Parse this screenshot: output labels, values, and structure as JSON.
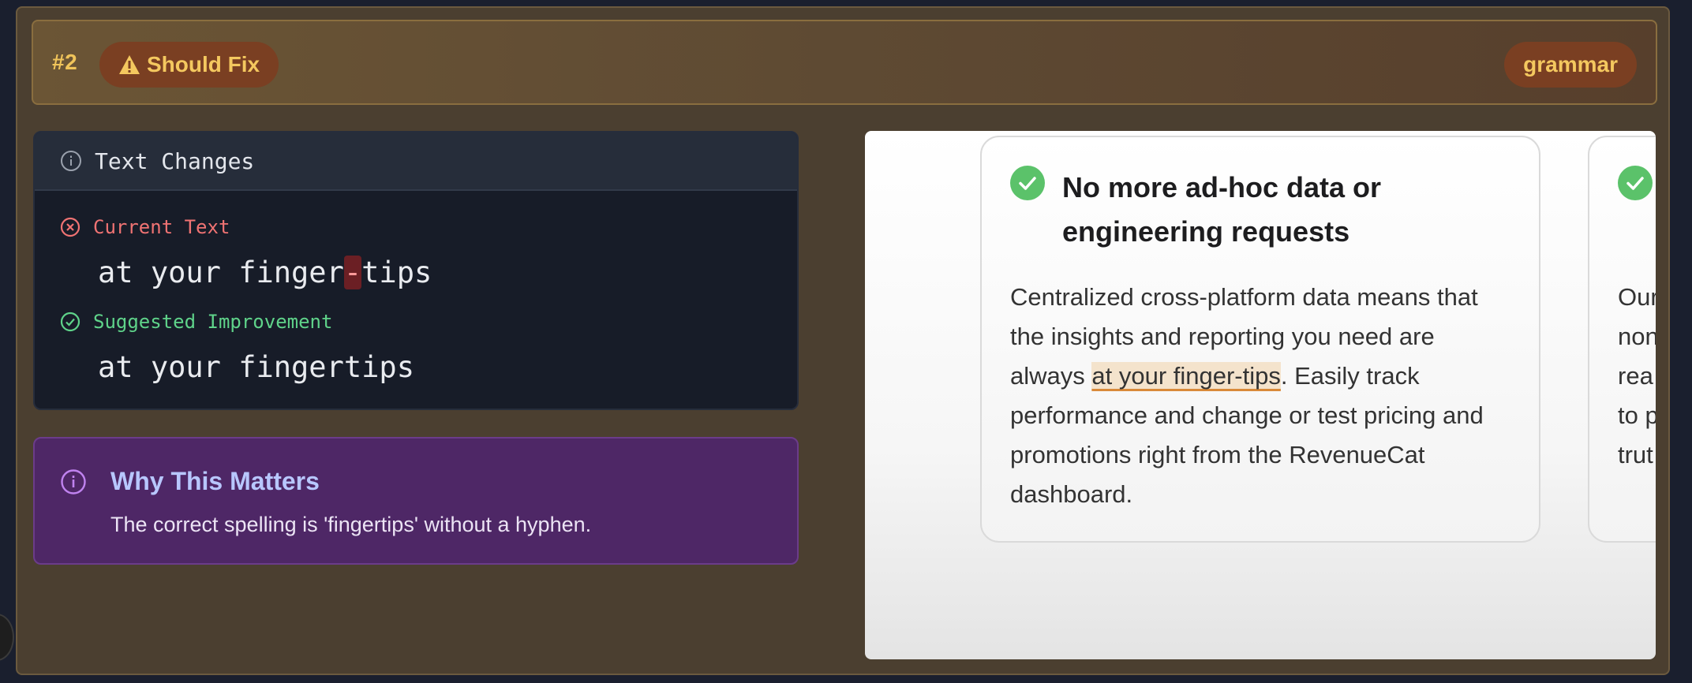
{
  "header": {
    "issue_number": "#2",
    "severity_label": "Should Fix",
    "severity_icon": "warning-icon",
    "category": "grammar",
    "accent_color": "#f4c85f"
  },
  "text_changes": {
    "title": "Text Changes",
    "current_label": "Current Text",
    "current_before": "at your finger",
    "current_removed": "-",
    "current_after": "tips",
    "suggested_label": "Suggested Improvement",
    "suggested_text": "at your fingertips"
  },
  "why": {
    "title": "Why This Matters",
    "text": "The correct spelling is 'fingertips' without a hyphen."
  },
  "preview": {
    "card_title": "No more ad-hoc data or engineering requests",
    "body_before": "Centralized cross-platform data means that the insights and reporting you need are always ",
    "body_highlight": "at your finger-tips",
    "body_after": ". Easily track performance and change or test pricing and promotions right from the RevenueCat dashboard.",
    "second_card_lines": [
      "Our",
      "non",
      "rea",
      "to p",
      "trut"
    ]
  }
}
